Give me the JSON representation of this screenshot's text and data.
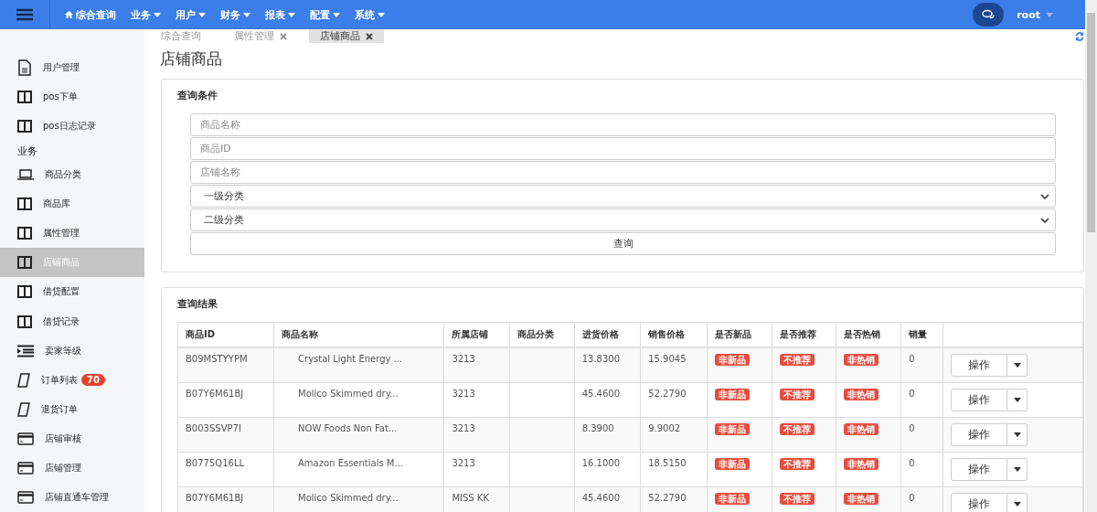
{
  "navbar": {
    "menu": [
      {
        "label": "综合查询",
        "kind": "home"
      },
      {
        "label": "业务",
        "kind": "dropdown"
      },
      {
        "label": "用户",
        "kind": "dropdown"
      },
      {
        "label": "财务",
        "kind": "dropdown"
      },
      {
        "label": "报表",
        "kind": "dropdown"
      },
      {
        "label": "配置",
        "kind": "dropdown"
      },
      {
        "label": "系统",
        "kind": "dropdown"
      }
    ],
    "user": "root"
  },
  "sidebar": {
    "items": [
      {
        "kind": "item",
        "label": "用户管理",
        "selected": false
      },
      {
        "kind": "item",
        "label": "pos下单",
        "selected": false
      },
      {
        "kind": "item",
        "label": "pos日志记录",
        "selected": false
      },
      {
        "kind": "header",
        "label": "业务"
      },
      {
        "kind": "item",
        "label": "商品分类",
        "selected": false
      },
      {
        "kind": "item",
        "label": "商品库",
        "selected": false
      },
      {
        "kind": "item",
        "label": "属性管理",
        "selected": false
      },
      {
        "kind": "item",
        "label": "店铺商品",
        "selected": true
      },
      {
        "kind": "item",
        "label": "借贷配置",
        "selected": false
      },
      {
        "kind": "item",
        "label": "借贷记录",
        "selected": false
      },
      {
        "kind": "item",
        "label": "卖家等级",
        "selected": false
      },
      {
        "kind": "item",
        "label": "订单列表",
        "selected": false,
        "badge": "70"
      },
      {
        "kind": "item",
        "label": "退货订单",
        "selected": false
      },
      {
        "kind": "item",
        "label": "店铺审核",
        "selected": false
      },
      {
        "kind": "item",
        "label": "店铺管理",
        "selected": false
      },
      {
        "kind": "item",
        "label": "店铺直通车管理",
        "selected": false
      }
    ]
  },
  "tabs": [
    {
      "label": "综合查询",
      "selected": false,
      "closable": false
    },
    {
      "label": "属性管理",
      "selected": false,
      "closable": true
    },
    {
      "label": "店铺商品",
      "selected": true,
      "closable": true
    }
  ],
  "page_title": "店铺商品",
  "query": {
    "title": "查询条件",
    "fields": [
      {
        "kind": "input",
        "placeholder": "商品名称"
      },
      {
        "kind": "input",
        "placeholder": "商品ID"
      },
      {
        "kind": "input",
        "placeholder": "店铺名称"
      },
      {
        "kind": "select",
        "value": "一级分类"
      },
      {
        "kind": "select",
        "value": "二级分类"
      }
    ],
    "button": "查询"
  },
  "results": {
    "title": "查询结果",
    "columns": [
      "商品ID",
      "商品名称",
      "所属店铺",
      "商品分类",
      "进货价格",
      "销售价格",
      "是否新品",
      "是否推荐",
      "是否热销",
      "销量"
    ],
    "rows": [
      {
        "id": "B09MSTYYPM",
        "name": "Crystal Light Energy ...",
        "shop": "3213",
        "category": "",
        "cost": "13.8300",
        "price": "15.9045",
        "new": "非新品",
        "recommend": "不推荐",
        "hot": "非热销",
        "sales": "0",
        "action": "操作"
      },
      {
        "id": "B07Y6M61BJ",
        "name": "Molico Skimmed dry...",
        "shop": "3213",
        "category": "",
        "cost": "45.4600",
        "price": "52.2790",
        "new": "非新品",
        "recommend": "不推荐",
        "hot": "非热销",
        "sales": "0",
        "action": "操作"
      },
      {
        "id": "B003SSVP7I",
        "name": "NOW Foods Non Fat...",
        "shop": "3213",
        "category": "",
        "cost": "8.3900",
        "price": "9.9002",
        "new": "非新品",
        "recommend": "不推荐",
        "hot": "非热销",
        "sales": "0",
        "action": "操作"
      },
      {
        "id": "B0775Q16LL",
        "name": "Amazon Essentials M...",
        "shop": "3213",
        "category": "",
        "cost": "16.1000",
        "price": "18.5150",
        "new": "非新品",
        "recommend": "不推荐",
        "hot": "非热销",
        "sales": "0",
        "action": "操作"
      },
      {
        "id": "B07Y6M61BJ",
        "name": "Molico Skimmed dry...",
        "shop": "MISS KK",
        "category": "",
        "cost": "45.4600",
        "price": "52.2790",
        "new": "非新品",
        "recommend": "不推荐",
        "hot": "非热销",
        "sales": "0",
        "action": "操作"
      }
    ]
  }
}
